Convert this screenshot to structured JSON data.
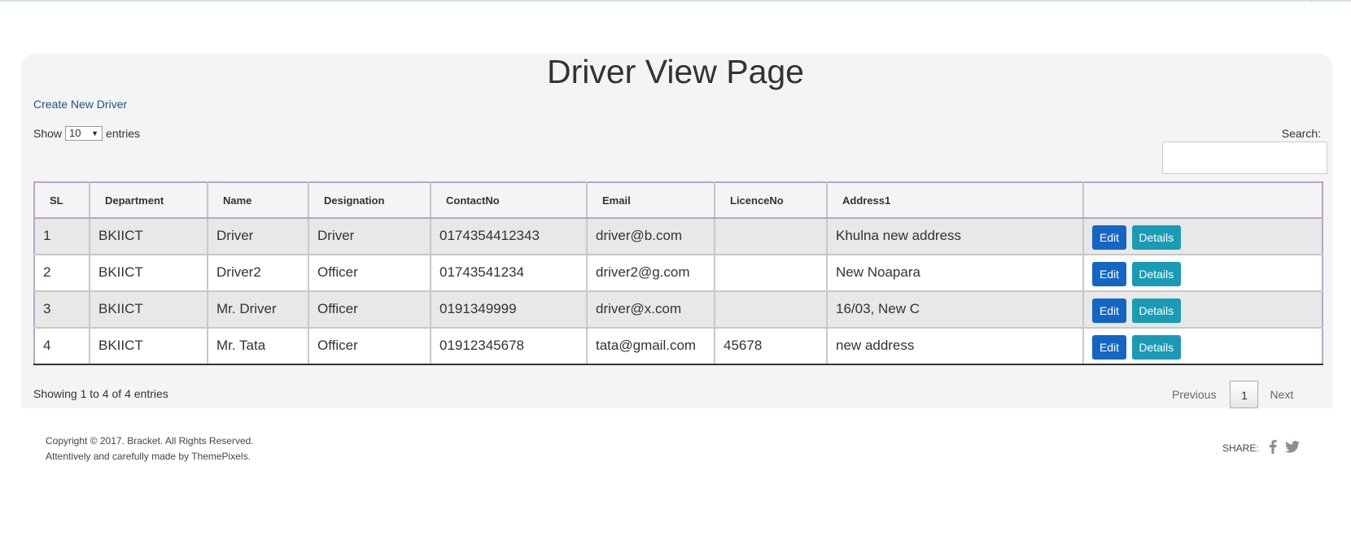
{
  "page": {
    "title": "Driver View Page",
    "create_link": "Create New Driver"
  },
  "length_menu": {
    "prefix": "Show",
    "selected": "10",
    "suffix": "entries"
  },
  "search": {
    "label": "Search:",
    "value": ""
  },
  "table": {
    "columns": [
      "SL",
      "Department",
      "Name",
      "Designation",
      "ContactNo",
      "Email",
      "LicenceNo",
      "Address1",
      ""
    ],
    "rows": [
      [
        "1",
        "BKIICT",
        "Driver",
        "Driver",
        "0174354412343",
        "driver@b.com",
        "",
        "Khulna new address"
      ],
      [
        "2",
        "BKIICT",
        "Driver2",
        "Officer",
        "01743541234",
        "driver2@g.com",
        "",
        "New Noapara"
      ],
      [
        "3",
        "BKIICT",
        "Mr. Driver",
        "Officer",
        "0191349999",
        "driver@x.com",
        "",
        "16/03, New C"
      ],
      [
        "4",
        "BKIICT",
        "Mr. Tata",
        "Officer",
        "01912345678",
        "tata@gmail.com",
        "45678",
        "new address"
      ]
    ],
    "edit_label": "Edit",
    "details_label": "Details"
  },
  "info": "Showing 1 to 4 of 4 entries",
  "pagination": {
    "previous": "Previous",
    "current": "1",
    "next": "Next"
  },
  "footer": {
    "copyright": "Copyright © 2017. Bracket. All Rights Reserved.",
    "credit": "Attentively and carefully made by ThemePixels.",
    "share_label": "SHARE:",
    "icons": [
      "facebook-icon",
      "twitter-icon"
    ]
  },
  "colors": {
    "edit_button": "#1466c4",
    "details_button": "#1a9bb5",
    "panel_background": "#f4f4f4",
    "link": "#1f4e8c"
  }
}
